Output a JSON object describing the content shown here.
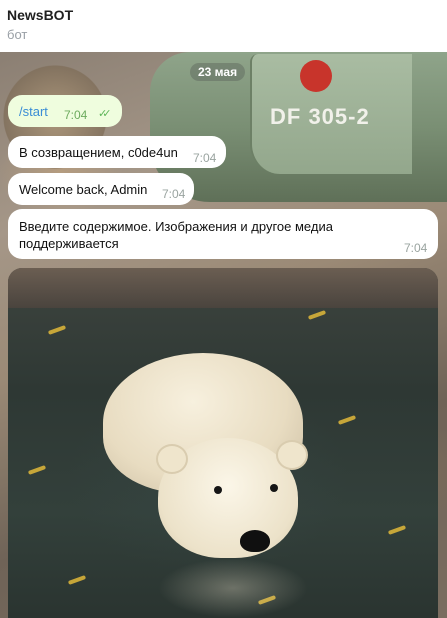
{
  "header": {
    "title": "NewsBOT",
    "subtitle": "бот"
  },
  "background": {
    "mecha_code": "DF 305-2"
  },
  "chat": {
    "date": "23 мая",
    "messages": [
      {
        "direction": "out",
        "text": "/start",
        "time": "7:04",
        "status_icon": "double-check-icon"
      },
      {
        "direction": "in",
        "text": "В созвращением, c0de4un",
        "time": "7:04"
      },
      {
        "direction": "in",
        "text": "Welcome back, Admin",
        "time": "7:04"
      },
      {
        "direction": "in",
        "text": "Введите содержимое. Изображения и другое медиа поддерживается",
        "time": "7:04"
      }
    ],
    "media": {
      "type": "photo",
      "subject_icon": "polar-bear-photo"
    }
  },
  "colors": {
    "outgoing_bubble": "#effdde",
    "incoming_bubble": "#ffffff",
    "link_blue": "#3a8dd6",
    "check_green": "#5fb65a"
  }
}
